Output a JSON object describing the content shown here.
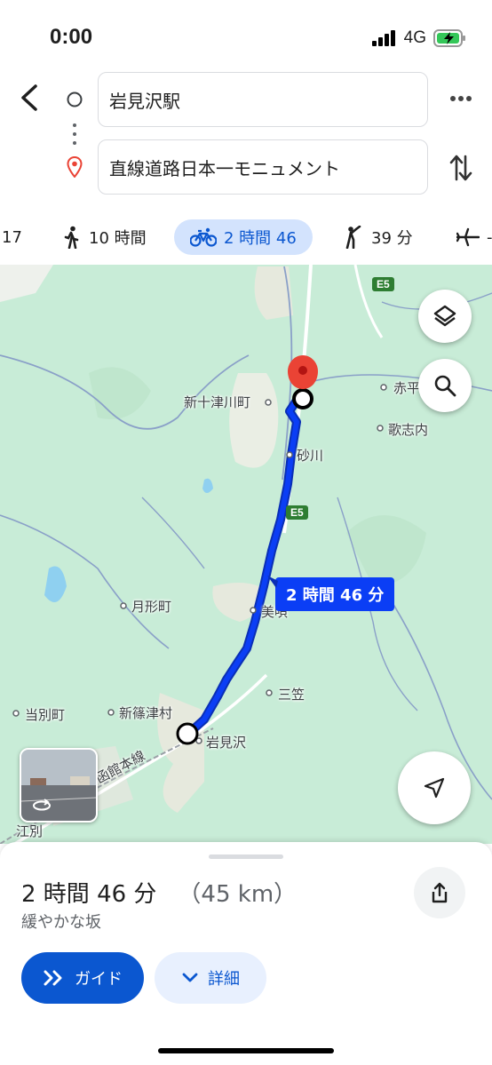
{
  "status": {
    "time": "0:00",
    "network": "4G"
  },
  "route": {
    "origin": "岩見沢駅",
    "destination": "直線道路日本一モニュメント"
  },
  "modes": [
    {
      "icon": "car-icon",
      "label": "17"
    },
    {
      "icon": "walk-icon",
      "label": "10 時間"
    },
    {
      "icon": "bicycle-icon",
      "label": "2 時間 46",
      "active": true
    },
    {
      "icon": "rideshare-icon",
      "label": "39 分"
    },
    {
      "icon": "plane-icon",
      "label": "-"
    }
  ],
  "map": {
    "labels": [
      "新十津川町",
      "赤平",
      "歌志内",
      "砂川",
      "月形町",
      "美唄",
      "三笠",
      "当別町",
      "新篠津村",
      "岩見沢",
      "函館本線",
      "江別"
    ],
    "highways": [
      "E5",
      "E5"
    ],
    "route_label": "2 時間 46 分",
    "route_color": "#0b3ef5"
  },
  "summary": {
    "duration": "2 時間 46 分",
    "distance": "（45 km）",
    "note": "緩やかな坂"
  },
  "buttons": {
    "guide": "ガイド",
    "details": "詳細"
  },
  "colors": {
    "accent": "#0b57d0",
    "map_bg": "#c8ecd7",
    "route": "#0b3ef5",
    "pin": "#ea4335"
  }
}
